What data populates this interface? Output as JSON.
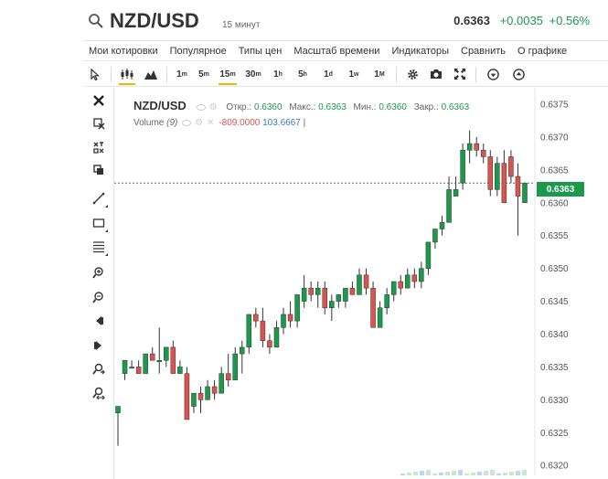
{
  "header": {
    "symbol": "NZD/USD",
    "timeframe": "15 минут",
    "last_price": "0.6363",
    "change_abs": "+0.0035",
    "change_pct": "+0.56%"
  },
  "menu": [
    "Мои котировки",
    "Популярное",
    "Типы цен",
    "Масштаб времени",
    "Индикаторы",
    "Сравнить",
    "О графике"
  ],
  "toolbar": {
    "intervals": [
      {
        "num": "1",
        "unit": "m"
      },
      {
        "num": "5",
        "unit": "m"
      },
      {
        "num": "15",
        "unit": "m",
        "active": true
      },
      {
        "num": "30",
        "unit": "m"
      },
      {
        "num": "1",
        "unit": "h"
      },
      {
        "num": "5",
        "unit": "h"
      },
      {
        "num": "1",
        "unit": "d"
      },
      {
        "num": "1",
        "unit": "w"
      },
      {
        "num": "1",
        "unit": "M"
      }
    ]
  },
  "legend": {
    "symbol": "NZD/USD",
    "open_label": "Откр.:",
    "open": "0.6360",
    "high_label": "Макс.:",
    "high": "0.6363",
    "low_label": "Мин.:",
    "low": "0.6360",
    "close_label": "Закр.:",
    "close": "0.6363",
    "volume_label": "Volume",
    "volume_period": "(9)",
    "volume_neg": "-809.0000",
    "volume_pos": "103.6667",
    "volume_sep": "|"
  },
  "current_price_label": "0.6363",
  "colors": {
    "up": "#1a9a4a",
    "down": "#d9534f",
    "accent": "#f0b400"
  },
  "chart_data": {
    "type": "candlestick",
    "yaxis_ticks": [
      "0.6375",
      "0.6370",
      "0.6365",
      "0.6360",
      "0.6355",
      "0.6350",
      "0.6345",
      "0.6340",
      "0.6335",
      "0.6330",
      "0.6325",
      "0.6320"
    ],
    "ylim": [
      0.63185,
      0.63775
    ],
    "current_price": 0.6363,
    "candles": [
      [
        0.6328,
        0.6329,
        0.6323,
        0.6329
      ],
      [
        0.6334,
        0.6336,
        0.6333,
        0.6336
      ],
      [
        0.6335,
        0.6336,
        0.6335,
        0.6335
      ],
      [
        0.6335,
        0.6336,
        0.6334,
        0.6334
      ],
      [
        0.6334,
        0.6337,
        0.6334,
        0.6337
      ],
      [
        0.6337,
        0.6338,
        0.6336,
        0.6336
      ],
      [
        0.6336,
        0.6341,
        0.6334,
        0.6336
      ],
      [
        0.6336,
        0.6338,
        0.6335,
        0.6338
      ],
      [
        0.6338,
        0.6339,
        0.6334,
        0.6334
      ],
      [
        0.6334,
        0.6336,
        0.6334,
        0.6335
      ],
      [
        0.6334,
        0.6335,
        0.6327,
        0.6327
      ],
      [
        0.6329,
        0.6331,
        0.6328,
        0.6331
      ],
      [
        0.6331,
        0.6332,
        0.6328,
        0.633
      ],
      [
        0.633,
        0.6333,
        0.633,
        0.6332
      ],
      [
        0.6332,
        0.6333,
        0.633,
        0.6331
      ],
      [
        0.6331,
        0.6335,
        0.6331,
        0.6334
      ],
      [
        0.6334,
        0.6337,
        0.6332,
        0.6333
      ],
      [
        0.6333,
        0.6338,
        0.6333,
        0.6337
      ],
      [
        0.6337,
        0.6339,
        0.6334,
        0.6338
      ],
      [
        0.6338,
        0.6343,
        0.6337,
        0.6343
      ],
      [
        0.6343,
        0.6344,
        0.6341,
        0.6342
      ],
      [
        0.6342,
        0.6344,
        0.6338,
        0.6339
      ],
      [
        0.6339,
        0.634,
        0.6337,
        0.6338
      ],
      [
        0.6338,
        0.6342,
        0.6338,
        0.6341
      ],
      [
        0.6341,
        0.6344,
        0.634,
        0.6343
      ],
      [
        0.6343,
        0.6345,
        0.6341,
        0.6342
      ],
      [
        0.6342,
        0.6346,
        0.6341,
        0.6346
      ],
      [
        0.6345,
        0.6349,
        0.6344,
        0.6347
      ],
      [
        0.6347,
        0.6348,
        0.6345,
        0.6346
      ],
      [
        0.6346,
        0.6348,
        0.6344,
        0.6347
      ],
      [
        0.6347,
        0.6348,
        0.6343,
        0.6344
      ],
      [
        0.6344,
        0.6346,
        0.6342,
        0.6345
      ],
      [
        0.6345,
        0.6346,
        0.6344,
        0.6346
      ],
      [
        0.6345,
        0.6347,
        0.6344,
        0.6347
      ],
      [
        0.6347,
        0.6348,
        0.6346,
        0.6346
      ],
      [
        0.6346,
        0.635,
        0.6346,
        0.6349
      ],
      [
        0.6349,
        0.635,
        0.6346,
        0.6347
      ],
      [
        0.6347,
        0.6348,
        0.6341,
        0.6341
      ],
      [
        0.6341,
        0.6345,
        0.6341,
        0.6344
      ],
      [
        0.6344,
        0.6347,
        0.6343,
        0.6346
      ],
      [
        0.6346,
        0.6348,
        0.6345,
        0.6348
      ],
      [
        0.6348,
        0.6349,
        0.6346,
        0.6347
      ],
      [
        0.6347,
        0.635,
        0.6347,
        0.6349
      ],
      [
        0.6349,
        0.635,
        0.6347,
        0.6348
      ],
      [
        0.6348,
        0.6351,
        0.6347,
        0.635
      ],
      [
        0.635,
        0.6354,
        0.6349,
        0.6354
      ],
      [
        0.6354,
        0.6356,
        0.6353,
        0.6356
      ],
      [
        0.6356,
        0.6358,
        0.6355,
        0.6357
      ],
      [
        0.6357,
        0.6364,
        0.6357,
        0.6362
      ],
      [
        0.6361,
        0.6364,
        0.6361,
        0.6362
      ],
      [
        0.6363,
        0.6369,
        0.6362,
        0.6368
      ],
      [
        0.6368,
        0.6371,
        0.6366,
        0.6369
      ],
      [
        0.6369,
        0.637,
        0.6367,
        0.6368
      ],
      [
        0.6368,
        0.6369,
        0.6366,
        0.6367
      ],
      [
        0.6367,
        0.6368,
        0.6361,
        0.6362
      ],
      [
        0.6362,
        0.6367,
        0.6361,
        0.6366
      ],
      [
        0.6366,
        0.6368,
        0.636,
        0.636
      ],
      [
        0.6367,
        0.6368,
        0.6363,
        0.6364
      ],
      [
        0.6364,
        0.6366,
        0.6355,
        0.6361
      ],
      [
        0.636,
        0.6363,
        0.636,
        0.6363
      ]
    ]
  }
}
